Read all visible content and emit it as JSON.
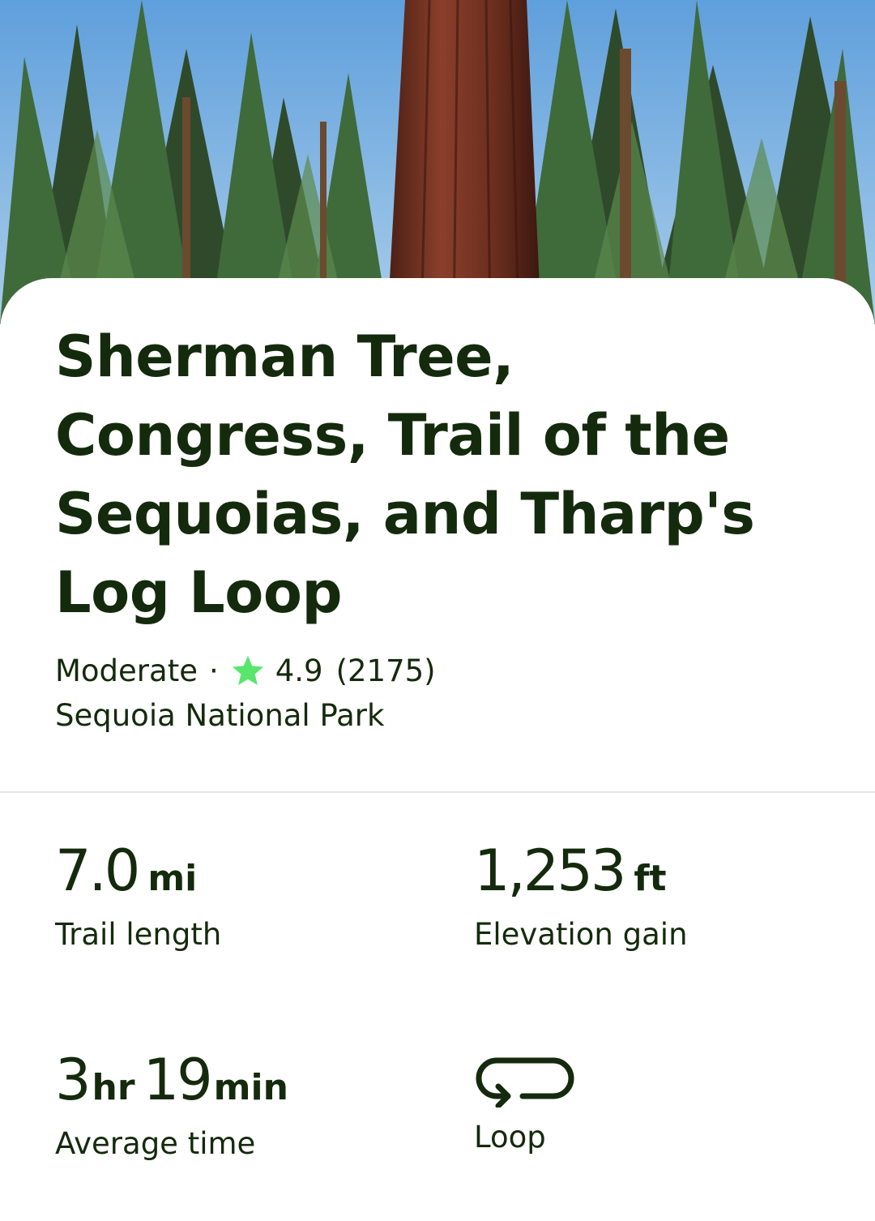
{
  "trail": {
    "title": "Sherman Tree, Congress, Trail of the Sequoias, and Tharp's Log Loop",
    "difficulty": "Moderate",
    "separator": "·",
    "rating": "4.9",
    "review_count": "(2175)",
    "park": "Sequoia National Park"
  },
  "stats": {
    "length": {
      "value": "7.0",
      "unit": "mi",
      "label": "Trail length"
    },
    "elevation": {
      "value": "1,253",
      "unit": "ft",
      "label": "Elevation gain"
    },
    "time": {
      "hours": "3",
      "hours_unit": "hr",
      "minutes": "19",
      "minutes_unit": "min",
      "label": "Average time"
    },
    "route_type": {
      "icon": "loop-icon",
      "label": "Loop"
    }
  },
  "colors": {
    "text": "#142a0c",
    "star": "#58e66d",
    "divider": "#e6e6e6",
    "sky": "#6aa8df"
  }
}
